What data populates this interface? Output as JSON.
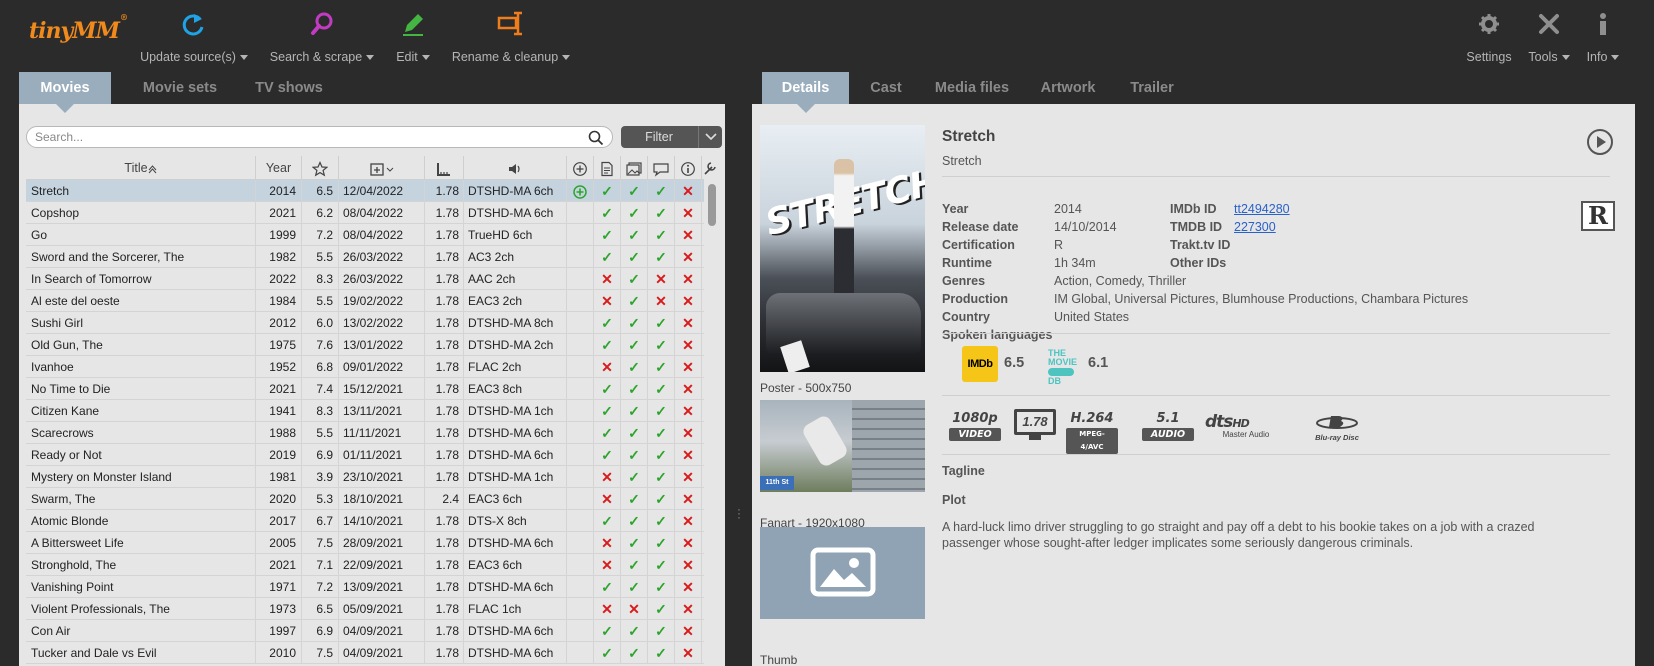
{
  "app": {
    "logo": "tinyMM",
    "logo_mark": "®"
  },
  "toolbar": {
    "update": "Update source(s)",
    "search": "Search & scrape",
    "edit": "Edit",
    "rename": "Rename & cleanup",
    "settings": "Settings",
    "tools": "Tools",
    "info": "Info"
  },
  "left_tabs": [
    "Movies",
    "Movie sets",
    "TV shows"
  ],
  "right_tabs": [
    "Details",
    "Cast",
    "Media files",
    "Artwork",
    "Trailer"
  ],
  "search": {
    "placeholder": "Search..."
  },
  "filter": {
    "label": "Filter"
  },
  "table": {
    "columns": {
      "title": "Title",
      "year": "Year"
    },
    "rows": [
      {
        "title": "Stretch",
        "year": "2014",
        "rating": "6.5",
        "date": "12/04/2022",
        "ar": "1.78",
        "audio": "DTSHD-MA 6ch",
        "i1": "plus",
        "i2": "ok",
        "i3": "ok",
        "i4": "ok",
        "i5": "no"
      },
      {
        "title": "Copshop",
        "year": "2021",
        "rating": "6.2",
        "date": "08/04/2022",
        "ar": "1.78",
        "audio": "DTSHD-MA 6ch",
        "i1": "",
        "i2": "ok",
        "i3": "ok",
        "i4": "ok",
        "i5": "no"
      },
      {
        "title": "Go",
        "year": "1999",
        "rating": "7.2",
        "date": "08/04/2022",
        "ar": "1.78",
        "audio": "TrueHD 6ch",
        "i1": "",
        "i2": "ok",
        "i3": "ok",
        "i4": "ok",
        "i5": "no"
      },
      {
        "title": "Sword and the Sorcerer, The",
        "year": "1982",
        "rating": "5.5",
        "date": "26/03/2022",
        "ar": "1.78",
        "audio": "AC3 2ch",
        "i1": "",
        "i2": "ok",
        "i3": "ok",
        "i4": "ok",
        "i5": "no"
      },
      {
        "title": "In Search of Tomorrow",
        "year": "2022",
        "rating": "8.3",
        "date": "26/03/2022",
        "ar": "1.78",
        "audio": "AAC 2ch",
        "i1": "",
        "i2": "no",
        "i3": "ok",
        "i4": "no",
        "i5": "no"
      },
      {
        "title": "Al este del oeste",
        "year": "1984",
        "rating": "5.5",
        "date": "19/02/2022",
        "ar": "1.78",
        "audio": "EAC3 2ch",
        "i1": "",
        "i2": "no",
        "i3": "ok",
        "i4": "no",
        "i5": "no"
      },
      {
        "title": "Sushi Girl",
        "year": "2012",
        "rating": "6.0",
        "date": "13/02/2022",
        "ar": "1.78",
        "audio": "DTSHD-MA 8ch",
        "i1": "",
        "i2": "ok",
        "i3": "ok",
        "i4": "ok",
        "i5": "no"
      },
      {
        "title": "Old Gun, The",
        "year": "1975",
        "rating": "7.6",
        "date": "13/01/2022",
        "ar": "1.78",
        "audio": "DTSHD-MA 2ch",
        "i1": "",
        "i2": "ok",
        "i3": "ok",
        "i4": "ok",
        "i5": "no"
      },
      {
        "title": "Ivanhoe",
        "year": "1952",
        "rating": "6.8",
        "date": "09/01/2022",
        "ar": "1.78",
        "audio": "FLAC 2ch",
        "i1": "",
        "i2": "no",
        "i3": "ok",
        "i4": "ok",
        "i5": "no"
      },
      {
        "title": "No Time to Die",
        "year": "2021",
        "rating": "7.4",
        "date": "15/12/2021",
        "ar": "1.78",
        "audio": "EAC3 8ch",
        "i1": "",
        "i2": "ok",
        "i3": "ok",
        "i4": "ok",
        "i5": "no"
      },
      {
        "title": "Citizen Kane",
        "year": "1941",
        "rating": "8.3",
        "date": "13/11/2021",
        "ar": "1.78",
        "audio": "DTSHD-MA 1ch",
        "i1": "",
        "i2": "ok",
        "i3": "ok",
        "i4": "ok",
        "i5": "no"
      },
      {
        "title": "Scarecrows",
        "year": "1988",
        "rating": "5.5",
        "date": "11/11/2021",
        "ar": "1.78",
        "audio": "DTSHD-MA 6ch",
        "i1": "",
        "i2": "ok",
        "i3": "ok",
        "i4": "ok",
        "i5": "no"
      },
      {
        "title": "Ready or Not",
        "year": "2019",
        "rating": "6.9",
        "date": "01/11/2021",
        "ar": "1.78",
        "audio": "DTSHD-MA 6ch",
        "i1": "",
        "i2": "ok",
        "i3": "ok",
        "i4": "ok",
        "i5": "no"
      },
      {
        "title": "Mystery on Monster Island",
        "year": "1981",
        "rating": "3.9",
        "date": "23/10/2021",
        "ar": "1.78",
        "audio": "DTSHD-MA 1ch",
        "i1": "",
        "i2": "no",
        "i3": "ok",
        "i4": "ok",
        "i5": "no"
      },
      {
        "title": "Swarm, The",
        "year": "2020",
        "rating": "5.3",
        "date": "18/10/2021",
        "ar": "2.4",
        "audio": "EAC3 6ch",
        "i1": "",
        "i2": "no",
        "i3": "ok",
        "i4": "ok",
        "i5": "no"
      },
      {
        "title": "Atomic Blonde",
        "year": "2017",
        "rating": "6.7",
        "date": "14/10/2021",
        "ar": "1.78",
        "audio": "DTS-X 8ch",
        "i1": "",
        "i2": "ok",
        "i3": "ok",
        "i4": "ok",
        "i5": "no"
      },
      {
        "title": "A Bittersweet Life",
        "year": "2005",
        "rating": "7.5",
        "date": "28/09/2021",
        "ar": "1.78",
        "audio": "DTSHD-MA 6ch",
        "i1": "",
        "i2": "no",
        "i3": "ok",
        "i4": "ok",
        "i5": "no"
      },
      {
        "title": "Stronghold, The",
        "year": "2021",
        "rating": "7.1",
        "date": "22/09/2021",
        "ar": "1.78",
        "audio": "EAC3 6ch",
        "i1": "",
        "i2": "no",
        "i3": "ok",
        "i4": "ok",
        "i5": "no"
      },
      {
        "title": "Vanishing Point",
        "year": "1971",
        "rating": "7.2",
        "date": "13/09/2021",
        "ar": "1.78",
        "audio": "DTSHD-MA 6ch",
        "i1": "",
        "i2": "ok",
        "i3": "ok",
        "i4": "ok",
        "i5": "no"
      },
      {
        "title": "Violent Professionals, The",
        "year": "1973",
        "rating": "6.5",
        "date": "05/09/2021",
        "ar": "1.78",
        "audio": "FLAC 1ch",
        "i1": "",
        "i2": "no",
        "i3": "no",
        "i4": "ok",
        "i5": "no"
      },
      {
        "title": "Con Air",
        "year": "1997",
        "rating": "6.9",
        "date": "04/09/2021",
        "ar": "1.78",
        "audio": "DTSHD-MA 6ch",
        "i1": "",
        "i2": "ok",
        "i3": "ok",
        "i4": "ok",
        "i5": "no"
      },
      {
        "title": "Tucker and Dale vs Evil",
        "year": "2010",
        "rating": "7.5",
        "date": "04/09/2021",
        "ar": "1.78",
        "audio": "DTSHD-MA 6ch",
        "i1": "",
        "i2": "ok",
        "i3": "ok",
        "i4": "ok",
        "i5": "no"
      }
    ]
  },
  "details": {
    "title": "Stretch",
    "original_title": "Stretch",
    "poster_caption": "Poster - 500x750",
    "poster_text": "STRETCH",
    "fanart_caption": "Fanart - 1920x1080",
    "fanart_sign": "11th St",
    "thumb_caption": "Thumb",
    "labels": {
      "year": "Year",
      "release": "Release date",
      "cert": "Certification",
      "runtime": "Runtime",
      "genres": "Genres",
      "production": "Production",
      "country": "Country",
      "languages": "Spoken languages",
      "imdb": "IMDb ID",
      "tmdb": "TMDB ID",
      "trakt": "Trakt.tv ID",
      "other": "Other IDs",
      "tagline": "Tagline",
      "plot": "Plot"
    },
    "year": "2014",
    "release": "14/10/2014",
    "cert": "R",
    "cert_badge": "R",
    "runtime": "1h 34m",
    "genres": "Action, Comedy, Thriller",
    "production": "IM Global, Universal Pictures, Blumhouse Productions, Chambara Pictures",
    "country": "United States",
    "imdb_id": "tt2494280",
    "tmdb_id": "227300",
    "imdb_logo": "IMDb",
    "imdb_rating": "6.5",
    "tmdb_logo_top": "THE",
    "tmdb_logo_mid": "MOVIE",
    "tmdb_logo_bot": "DB",
    "tmdb_rating": "6.1",
    "flags": {
      "res": "1080p",
      "res_sub": "VIDEO",
      "ar": "1.78",
      "codec": "H.264",
      "codec_sub": "MPEG-4/AVC",
      "ch": "5.1",
      "ch_sub": "AUDIO",
      "dts": "dts",
      "dts_hd": "HD",
      "dts_sub": "Master Audio",
      "bluray": "Blu-ray Disc"
    },
    "plot": "A hard-luck limo driver struggling to go straight and pay off a debt to his bookie takes on a job with a crazed passenger whose sought-after ledger implicates some seriously dangerous criminals."
  },
  "colors": {
    "accent": "#f08a1c",
    "tab_active": "#9aadbd",
    "ok": "#2da52d",
    "no": "#d81b1b",
    "link": "#2a62c9"
  }
}
